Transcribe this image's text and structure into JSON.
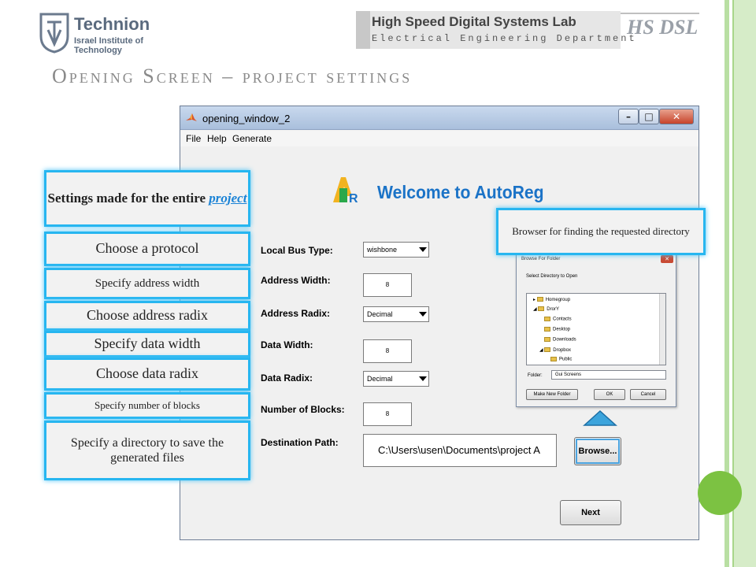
{
  "header": {
    "technion_name": "Technion",
    "technion_sub": "Israel Institute of Technology",
    "lab_title": "High Speed Digital Systems Lab",
    "lab_dept": "Electrical Engineering Department",
    "lab_logo": "HS DSL"
  },
  "slide_title": "Opening Screen – project settings",
  "window": {
    "title": "opening_window_2",
    "menu": [
      "File",
      "Help",
      "Generate"
    ],
    "welcome": "Welcome to AutoReg"
  },
  "form": {
    "local_bus_label": "Local Bus Type:",
    "local_bus_value": "wishbone",
    "addr_width_label": "Address Width:",
    "addr_width_value": "8",
    "addr_radix_label": "Address Radix:",
    "addr_radix_value": "Decimal",
    "data_width_label": "Data Width:",
    "data_width_value": "8",
    "data_radix_label": "Data Radix:",
    "data_radix_value": "Decimal",
    "blocks_label": "Number of Blocks:",
    "blocks_value": "8",
    "dest_label": "Destination Path:",
    "dest_value": "C:\\Users\\usen\\Documents\\project A",
    "browse_button": "Browse...",
    "next_button": "Next"
  },
  "dialog": {
    "title": "Browse For Folder",
    "instruction": "Select Directory to Open",
    "tree": [
      "Homegroup",
      "DrorY",
      "Contacts",
      "Desktop",
      "Downloads",
      "Dropbox",
      "Public"
    ],
    "folder_label": "Folder:",
    "folder_value": "Gui Screens",
    "make_new_folder": "Make New Folder",
    "ok": "OK",
    "cancel": "Cancel"
  },
  "callouts": {
    "settings_prefix": "Settings made for the entire",
    "settings_link": "project",
    "protocol": "Choose a protocol",
    "addr_width": "Specify address width",
    "addr_radix": "Choose address radix",
    "data_width": "Specify data width",
    "data_radix": "Choose data radix",
    "blocks": "Specify number of blocks",
    "directory": "Specify a directory to save the generated files",
    "browser": "Browser for finding the requested directory"
  },
  "colors": {
    "callout_border": "#27b6f0",
    "welcome_blue": "#1b73c7",
    "green_accent": "#7cc242"
  }
}
